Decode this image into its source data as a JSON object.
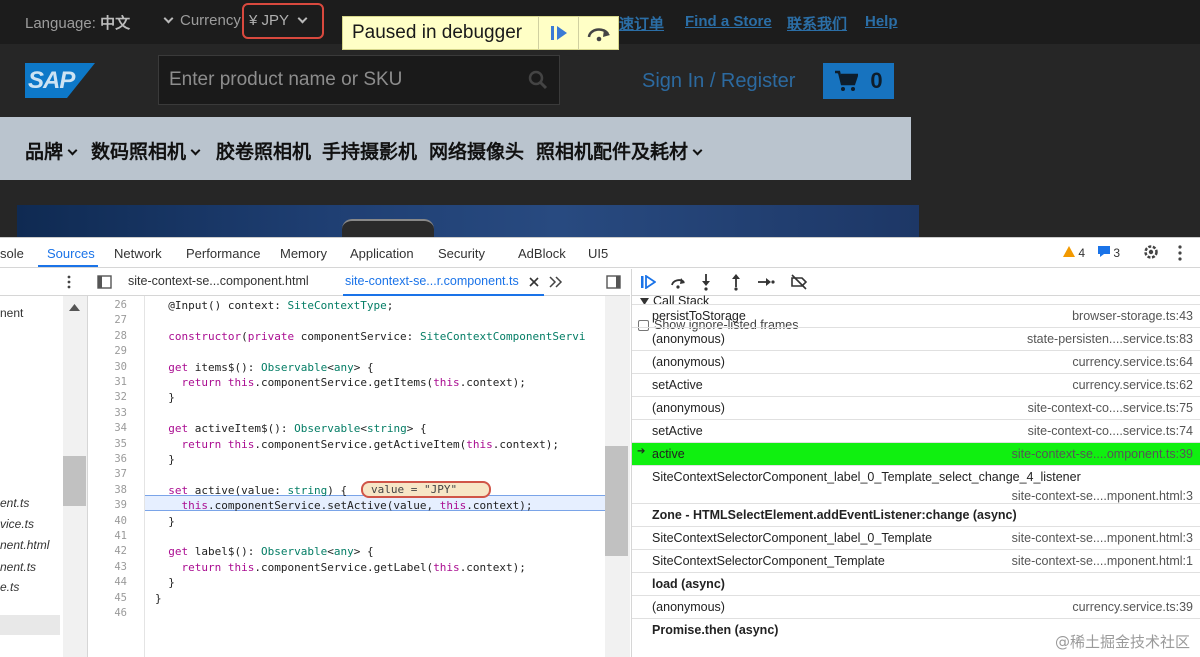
{
  "site": {
    "language_label": "Language:",
    "language_value": "中文",
    "currency_label": "Currency",
    "currency_value": "¥ JPY",
    "links": [
      "速订单",
      "Find a Store",
      "联系我们",
      "Help"
    ],
    "debugger_banner": "Paused in debugger",
    "logo_text": "SAP",
    "search_placeholder": "Enter product name or SKU",
    "sign_in": "Sign In / Register",
    "cart_count": "0",
    "nav": [
      "品牌",
      "数码照相机",
      "胶卷照相机",
      "手持摄影机",
      "网络摄像头",
      "照相机配件及耗材"
    ]
  },
  "devtools": {
    "tabs": [
      "sole",
      "Sources",
      "Network",
      "Performance",
      "Memory",
      "Application",
      "Security",
      "AdBlock",
      "UI5"
    ],
    "active_tab": "Sources",
    "warnings_count": "4",
    "messages_count": "3",
    "file_tabs": [
      "site-context-se...component.html",
      "site-context-se...r.component.ts"
    ],
    "navigator_files": [
      "nent",
      "ent.ts",
      "vice.ts",
      "nent.html",
      "nent.ts",
      "e.ts"
    ],
    "code_lines": [
      {
        "n": "26",
        "t": "  @Input() context: SiteContextType;"
      },
      {
        "n": "27",
        "t": ""
      },
      {
        "n": "28",
        "t": "  constructor(private componentService: SiteContextComponentServi"
      },
      {
        "n": "29",
        "t": ""
      },
      {
        "n": "30",
        "t": "  get items$(): Observable<any> {"
      },
      {
        "n": "31",
        "t": "    return this.componentService.getItems(this.context);"
      },
      {
        "n": "32",
        "t": "  }"
      },
      {
        "n": "33",
        "t": ""
      },
      {
        "n": "34",
        "t": "  get activeItem$(): Observable<string> {"
      },
      {
        "n": "35",
        "t": "    return this.componentService.getActiveItem(this.context);"
      },
      {
        "n": "36",
        "t": "  }"
      },
      {
        "n": "37",
        "t": ""
      },
      {
        "n": "38",
        "t": "  set active(value: string) {"
      },
      {
        "n": "39",
        "t": "    this.componentService.setActive(value, this.context);"
      },
      {
        "n": "40",
        "t": "  }"
      },
      {
        "n": "41",
        "t": ""
      },
      {
        "n": "42",
        "t": "  get label$(): Observable<any> {"
      },
      {
        "n": "43",
        "t": "    return this.componentService.getLabel(this.context);"
      },
      {
        "n": "44",
        "t": "  }"
      },
      {
        "n": "45",
        "t": "}"
      },
      {
        "n": "46",
        "t": ""
      }
    ],
    "inline_value": "value = \"JPY\"",
    "call_stack_title": "Call Stack",
    "ignore_listed_label": "Show ignore-listed frames",
    "frames": [
      {
        "fn": "persistToStorage",
        "loc": "browser-storage.ts:43"
      },
      {
        "fn": "(anonymous)",
        "loc": "state-persisten....service.ts:83"
      },
      {
        "fn": "(anonymous)",
        "loc": "currency.service.ts:64"
      },
      {
        "fn": "setActive",
        "loc": "currency.service.ts:62"
      },
      {
        "fn": "(anonymous)",
        "loc": "site-context-co....service.ts:75"
      },
      {
        "fn": "setActive",
        "loc": "site-context-co....service.ts:74"
      },
      {
        "fn": "active",
        "loc": "site-context-se....omponent.ts:39"
      },
      {
        "fn": "SiteContextSelectorComponent_label_0_Template_select_change_4_listener",
        "loc": "site-context-se....mponent.html:3"
      },
      {
        "fn": "Zone - HTMLSelectElement.addEventListener:change (async)",
        "loc": ""
      },
      {
        "fn": "SiteContextSelectorComponent_label_0_Template",
        "loc": "site-context-se....mponent.html:3"
      },
      {
        "fn": "SiteContextSelectorComponent_Template",
        "loc": "site-context-se....mponent.html:1"
      },
      {
        "fn": "load (async)",
        "loc": ""
      },
      {
        "fn": "(anonymous)",
        "loc": "currency.service.ts:39"
      },
      {
        "fn": "Promise.then (async)",
        "loc": ""
      }
    ],
    "watermark": "@稀土掘金技术社区"
  },
  "colors": {
    "site_bg": "#262626",
    "link_blue": "#2b6ea6",
    "debug_banner": "#ffffc6",
    "active_frame": "#10f010",
    "devtools_accent": "#1a73e8"
  }
}
